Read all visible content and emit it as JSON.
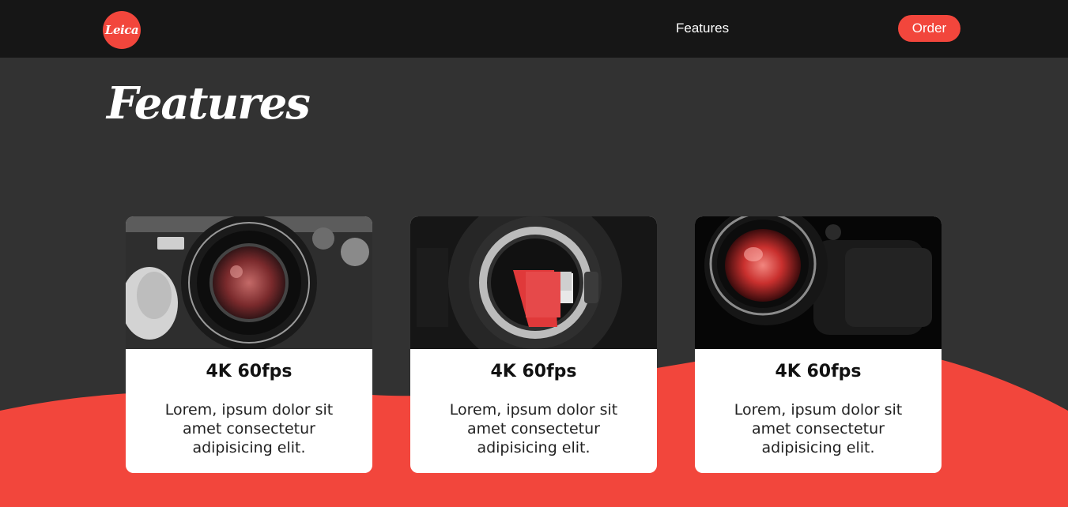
{
  "brand": {
    "logo_text": "Leica",
    "accent_color": "#f2463c"
  },
  "nav": {
    "links": [
      "Features"
    ],
    "order_label": "Order"
  },
  "page": {
    "title": "Features"
  },
  "features": [
    {
      "title": "4K 60fps",
      "text": "Lorem, ipsum dolor sit amet consectetur adipisicing elit.",
      "image": "rangefinder-camera-lens"
    },
    {
      "title": "4K 60fps",
      "text": "Lorem, ipsum dolor sit amet consectetur adipisicing elit.",
      "image": "mirrorless-camera-mount"
    },
    {
      "title": "4K 60fps",
      "text": "Lorem, ipsum dolor sit amet consectetur adipisicing elit.",
      "image": "camera-lens-red-glass"
    }
  ]
}
